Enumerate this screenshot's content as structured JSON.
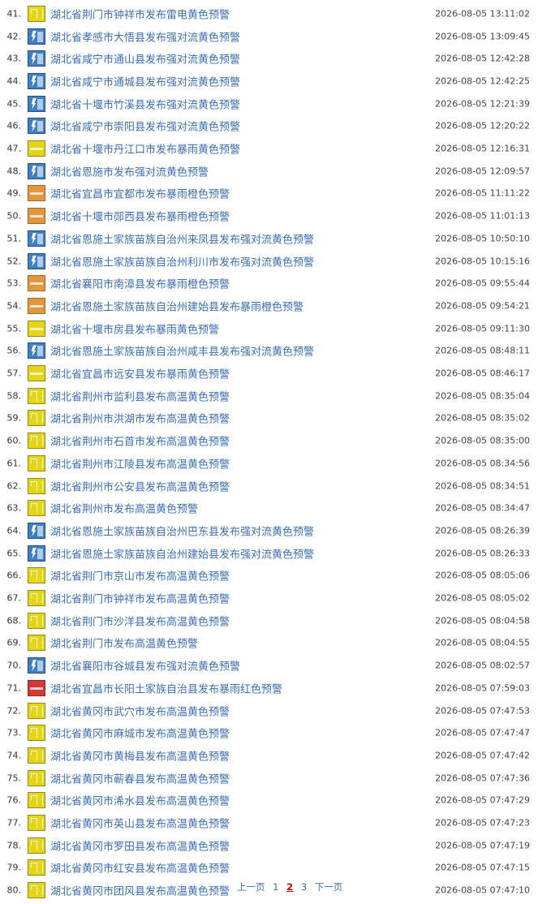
{
  "alerts": [
    {
      "num": "41.",
      "title": "湖北省荆门市钟祥市发布雷电黄色预警",
      "time": "2026-08-05 13:11:02",
      "icon": "yellow-grid"
    },
    {
      "num": "42.",
      "title": "湖北省孝感市大悟县发布强对流黄色预警",
      "time": "2026-08-05 13:09:45",
      "icon": "blue-bolt"
    },
    {
      "num": "43.",
      "title": "湖北省咸宁市通山县发布强对流黄色预警",
      "time": "2026-08-05 12:42:28",
      "icon": "blue-bolt"
    },
    {
      "num": "44.",
      "title": "湖北省咸宁市通城县发布强对流黄色预警",
      "time": "2026-08-05 12:42:25",
      "icon": "blue-bolt"
    },
    {
      "num": "45.",
      "title": "湖北省十堰市竹溪县发布强对流黄色预警",
      "time": "2026-08-05 12:21:39",
      "icon": "blue-bolt"
    },
    {
      "num": "46.",
      "title": "湖北省咸宁市崇阳县发布强对流黄色预警",
      "time": "2026-08-05 12:20:22",
      "icon": "blue-bolt"
    },
    {
      "num": "47.",
      "title": "湖北省十堰市丹江口市发布暴雨黄色预警",
      "time": "2026-08-05 12:16:31",
      "icon": "yellow-bar"
    },
    {
      "num": "48.",
      "title": "湖北省恩施市发布强对流黄色预警",
      "time": "2026-08-05 12:09:57",
      "icon": "blue-bolt"
    },
    {
      "num": "49.",
      "title": "湖北省宜昌市宜都市发布暴雨橙色预警",
      "time": "2026-08-05 11:11:22",
      "icon": "orange-bar"
    },
    {
      "num": "50.",
      "title": "湖北省十堰市郧西县发布暴雨橙色预警",
      "time": "2026-08-05 11:01:13",
      "icon": "orange-bar"
    },
    {
      "num": "51.",
      "title": "湖北省恩施土家族苗族自治州来凤县发布强对流黄色预警",
      "time": "2026-08-05 10:50:10",
      "icon": "blue-bolt"
    },
    {
      "num": "52.",
      "title": "湖北省恩施土家族苗族自治州利川市发布强对流黄色预警",
      "time": "2026-08-05 10:15:16",
      "icon": "blue-bolt"
    },
    {
      "num": "53.",
      "title": "湖北省襄阳市南漳县发布暴雨橙色预警",
      "time": "2026-08-05 09:55:44",
      "icon": "orange-bar"
    },
    {
      "num": "54.",
      "title": "湖北省恩施土家族苗族自治州建始县发布暴雨橙色预警",
      "time": "2026-08-05 09:54:21",
      "icon": "orange-bar"
    },
    {
      "num": "55.",
      "title": "湖北省十堰市房县发布暴雨黄色预警",
      "time": "2026-08-05 09:11:30",
      "icon": "yellow-bar"
    },
    {
      "num": "56.",
      "title": "湖北省恩施土家族苗族自治州咸丰县发布强对流黄色预警",
      "time": "2026-08-05 08:48:11",
      "icon": "blue-bolt"
    },
    {
      "num": "57.",
      "title": "湖北省宜昌市远安县发布暴雨黄色预警",
      "time": "2026-08-05 08:46:17",
      "icon": "yellow-bar"
    },
    {
      "num": "58.",
      "title": "湖北省荆州市监利县发布高温黄色预警",
      "time": "2026-08-05 08:35:04",
      "icon": "yellow-grid"
    },
    {
      "num": "59.",
      "title": "湖北省荆州市洪湖市发布高温黄色预警",
      "time": "2026-08-05 08:35:02",
      "icon": "yellow-grid"
    },
    {
      "num": "60.",
      "title": "湖北省荆州市石首市发布高温黄色预警",
      "time": "2026-08-05 08:35:00",
      "icon": "yellow-grid"
    },
    {
      "num": "61.",
      "title": "湖北省荆州市江陵县发布高温黄色预警",
      "time": "2026-08-05 08:34:56",
      "icon": "yellow-grid"
    },
    {
      "num": "62.",
      "title": "湖北省荆州市公安县发布高温黄色预警",
      "time": "2026-08-05 08:34:51",
      "icon": "yellow-grid"
    },
    {
      "num": "63.",
      "title": "湖北省荆州市发布高温黄色预警",
      "time": "2026-08-05 08:34:47",
      "icon": "yellow-grid"
    },
    {
      "num": "64.",
      "title": "湖北省恩施土家族苗族自治州巴东县发布强对流黄色预警",
      "time": "2026-08-05 08:26:39",
      "icon": "blue-bolt"
    },
    {
      "num": "65.",
      "title": "湖北省恩施土家族苗族自治州建始县发布强对流黄色预警",
      "time": "2026-08-05 08:26:33",
      "icon": "blue-bolt"
    },
    {
      "num": "66.",
      "title": "湖北省荆门市京山市发布高温黄色预警",
      "time": "2026-08-05 08:05:06",
      "icon": "yellow-grid"
    },
    {
      "num": "67.",
      "title": "湖北省荆门市钟祥市发布高温黄色预警",
      "time": "2026-08-05 08:05:02",
      "icon": "yellow-grid"
    },
    {
      "num": "68.",
      "title": "湖北省荆门市沙洋县发布高温黄色预警",
      "time": "2026-08-05 08:04:58",
      "icon": "yellow-grid"
    },
    {
      "num": "69.",
      "title": "湖北省荆门市发布高温黄色预警",
      "time": "2026-08-05 08:04:55",
      "icon": "yellow-grid"
    },
    {
      "num": "70.",
      "title": "湖北省襄阳市谷城县发布强对流黄色预警",
      "time": "2026-08-05 08:02:57",
      "icon": "blue-bolt"
    },
    {
      "num": "71.",
      "title": "湖北省宜昌市长阳土家族自治县发布暴雨红色预警",
      "time": "2026-08-05 07:59:03",
      "icon": "red-bar"
    },
    {
      "num": "72.",
      "title": "湖北省黄冈市武穴市发布高温黄色预警",
      "time": "2026-08-05 07:47:53",
      "icon": "yellow-grid"
    },
    {
      "num": "73.",
      "title": "湖北省黄冈市麻城市发布高温黄色预警",
      "time": "2026-08-05 07:47:47",
      "icon": "yellow-grid"
    },
    {
      "num": "74.",
      "title": "湖北省黄冈市黄梅县发布高温黄色预警",
      "time": "2026-08-05 07:47:42",
      "icon": "yellow-grid"
    },
    {
      "num": "75.",
      "title": "湖北省黄冈市蕲春县发布高温黄色预警",
      "time": "2026-08-05 07:47:36",
      "icon": "yellow-grid"
    },
    {
      "num": "76.",
      "title": "湖北省黄冈市浠水县发布高温黄色预警",
      "time": "2026-08-05 07:47:29",
      "icon": "yellow-grid"
    },
    {
      "num": "77.",
      "title": "湖北省黄冈市英山县发布高温黄色预警",
      "time": "2026-08-05 07:47:23",
      "icon": "yellow-grid"
    },
    {
      "num": "78.",
      "title": "湖北省黄冈市罗田县发布高温黄色预警",
      "time": "2026-08-05 07:47:19",
      "icon": "yellow-grid"
    },
    {
      "num": "79.",
      "title": "湖北省黄冈市红安县发布高温黄色预警",
      "time": "2026-08-05 07:47:15",
      "icon": "yellow-grid"
    },
    {
      "num": "80.",
      "title": "湖北省黄冈市团风县发布高温黄色预警",
      "time": "2026-08-05 07:47:10",
      "icon": "yellow-grid"
    }
  ],
  "pager": {
    "prev": "上一页",
    "pages": [
      "1",
      "2",
      "3"
    ],
    "current": "2",
    "next": "下一页"
  },
  "colors": {
    "link": "#3b6eb8",
    "current_page": "#c00000",
    "yellow_alert": "#e6d416",
    "orange_alert": "#e2973f",
    "red_alert": "#d23b33",
    "blue_alert": "#3f7fc4"
  }
}
